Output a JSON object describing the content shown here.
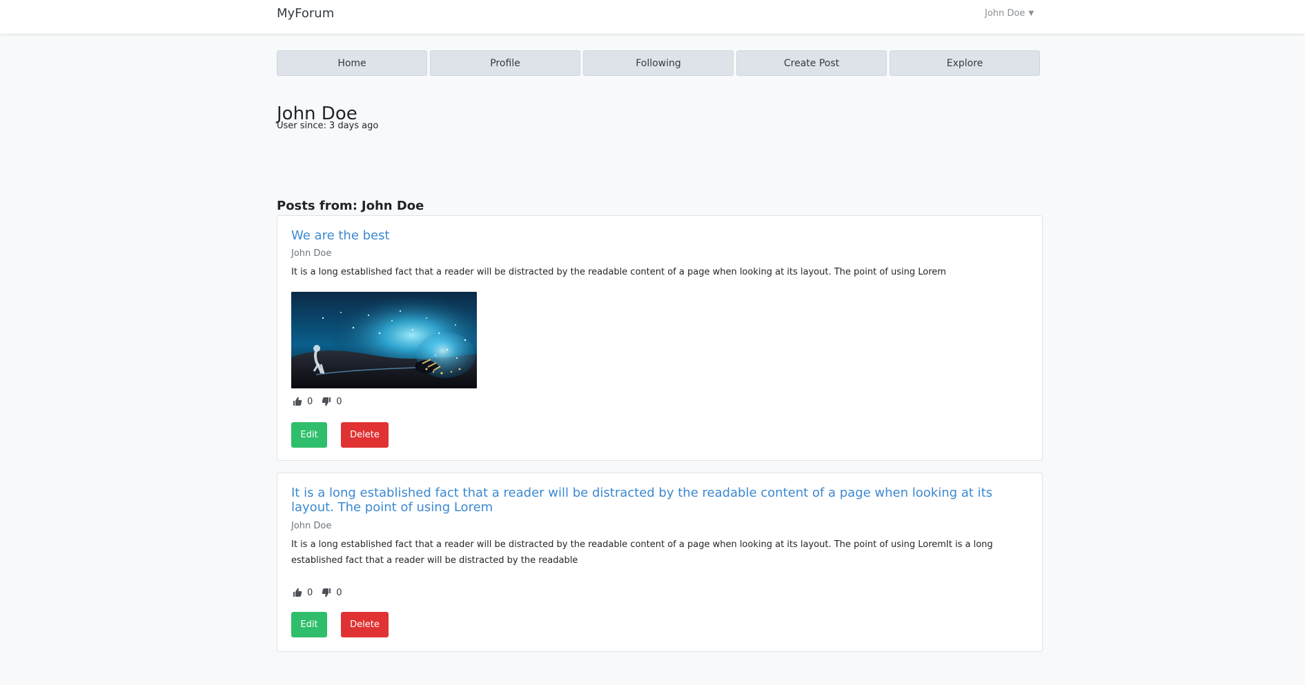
{
  "navbar": {
    "brand": "MyForum",
    "user": "John Doe"
  },
  "tabs": [
    {
      "label": "Home"
    },
    {
      "label": "Profile"
    },
    {
      "label": "Following"
    },
    {
      "label": "Create Post"
    },
    {
      "label": "Explore"
    }
  ],
  "profile": {
    "name": "John Doe",
    "user_since_label": "User since:",
    "user_since_value": "3 days ago"
  },
  "posts_section": {
    "heading_label": "Posts from:",
    "heading_user": "John Doe"
  },
  "posts": [
    {
      "title": "We are the best",
      "author": "John Doe",
      "body": "It is a long established fact that a reader will be distracted by the readable content of a page when looking at its layout. The point of using Lorem",
      "image_alt": "night-sky-lightbulb-image",
      "likes": "0",
      "dislikes": "0",
      "edit_label": "Edit",
      "delete_label": "Delete",
      "like_icon": "thumbs-up-icon",
      "dislike_icon": "thumbs-down-icon"
    },
    {
      "title": "It is a long established fact that a reader will be distracted by the readable content of a page when looking at its layout. The point of using Lorem",
      "author": "John Doe",
      "body": "It is a long established fact that a reader will be distracted by the readable content of a page when looking at its layout. The point of using LoremIt is a long established fact that a reader will be distracted by the readable",
      "likes": "0",
      "dislikes": "0",
      "edit_label": "Edit",
      "delete_label": "Delete",
      "like_icon": "thumbs-up-icon",
      "dislike_icon": "thumbs-down-icon"
    }
  ],
  "colors": {
    "background": "#f8f9fa",
    "link": "#3b88d1",
    "edit": "#2fbe6b",
    "delete": "#e03232",
    "tab": "#dde3e9"
  }
}
